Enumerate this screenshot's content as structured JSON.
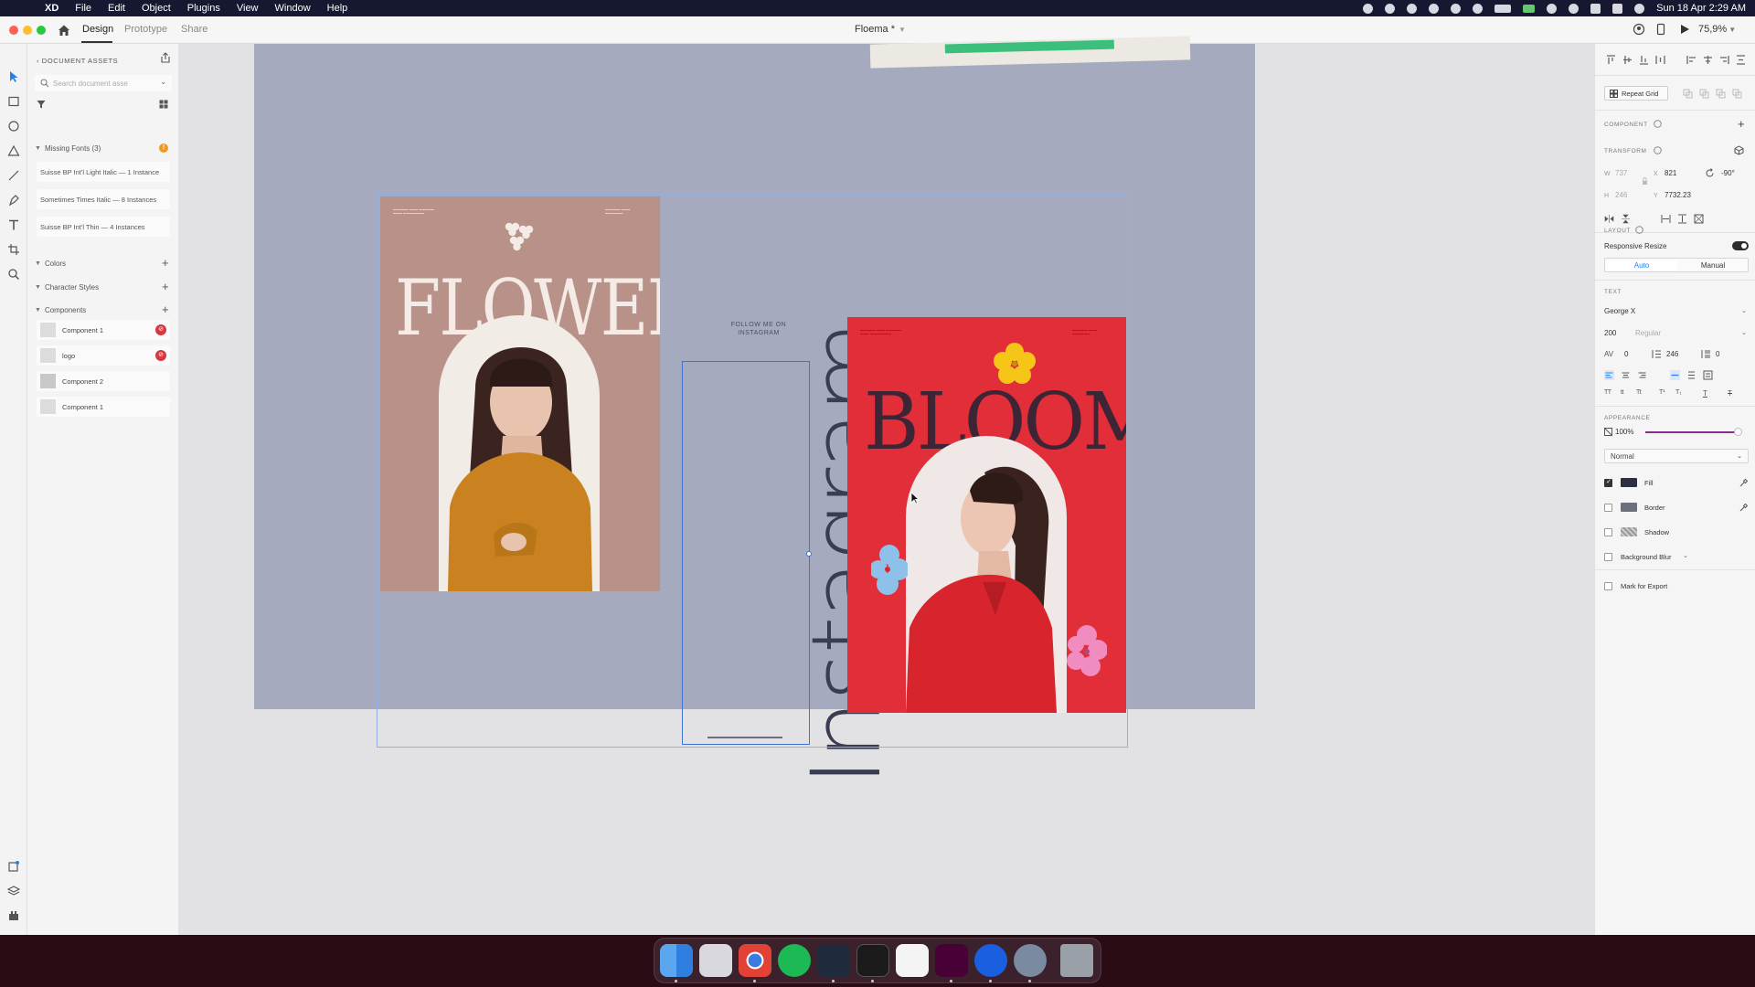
{
  "menubar": {
    "app_name": "XD",
    "items": [
      "File",
      "Edit",
      "Object",
      "Plugins",
      "View",
      "Window",
      "Help"
    ],
    "datetime": "Sun 18 Apr  2:29 AM"
  },
  "titlebar": {
    "tabs": {
      "design": "Design",
      "prototype": "Prototype",
      "share": "Share"
    },
    "document_title": "Floema *",
    "zoom": "75,9%"
  },
  "assets": {
    "title": "DOCUMENT ASSETS",
    "search_placeholder": "Search document asse",
    "missing_fonts": {
      "label": "Missing Fonts (3)",
      "badge": "!",
      "items": [
        "Suisse BP Int'l Light Italic — 1 Instance",
        "Sometimes Times Italic — 8 Instances",
        "Suisse BP Int'l Thin — 4 Instances"
      ]
    },
    "colors_label": "Colors",
    "char_styles_label": "Character Styles",
    "components_label": "Components",
    "components": [
      {
        "name": "Component 1",
        "warning": true
      },
      {
        "name": "logo",
        "warning": true
      },
      {
        "name": "Component 2",
        "warning": false
      },
      {
        "name": "Component 1",
        "warning": false
      }
    ]
  },
  "canvas": {
    "poster_flower": {
      "title": "FLOWER",
      "bg": "#b89289"
    },
    "follow_text": "FOLLOW ME ON\nINSTAGRAM",
    "instagram_word": "Instagram",
    "poster_bloom": {
      "title": "BLOOM",
      "bg": "#e12e38"
    }
  },
  "properties": {
    "repeat_grid": "Repeat Grid",
    "component_hdr": "COMPONENT",
    "transform_hdr": "TRANSFORM",
    "transform": {
      "w_label": "W",
      "w": "737",
      "x_label": "X",
      "x": "821",
      "rotation": "-90°",
      "h_label": "H",
      "h": "246",
      "y_label": "Y",
      "y": "7732.23"
    },
    "layout_hdr": "LAYOUT",
    "responsive_resize": "Responsive Resize",
    "resize_auto": "Auto",
    "resize_manual": "Manual",
    "text_hdr": "TEXT",
    "font_family": "George X",
    "font_size": "200",
    "font_weight": "Regular",
    "char_spacing": "0",
    "line_spacing": "246",
    "para_spacing": "0",
    "appearance_hdr": "APPEARANCE",
    "opacity": "100%",
    "blend_mode": "Normal",
    "fill_label": "Fill",
    "border_label": "Border",
    "shadow_label": "Shadow",
    "bg_blur_label": "Background Blur",
    "export_label": "Mark for Export",
    "fill_color": "#2e2f45",
    "border_color": "#6d6f7d"
  },
  "dock": {
    "apps": [
      "finder-icon",
      "launchpad-icon",
      "chrome-icon",
      "spotify-icon",
      "vscode-icon",
      "terminal-icon",
      "slack-icon",
      "xd-icon",
      "maps-icon",
      "quicktime-icon",
      "trash-icon"
    ]
  }
}
